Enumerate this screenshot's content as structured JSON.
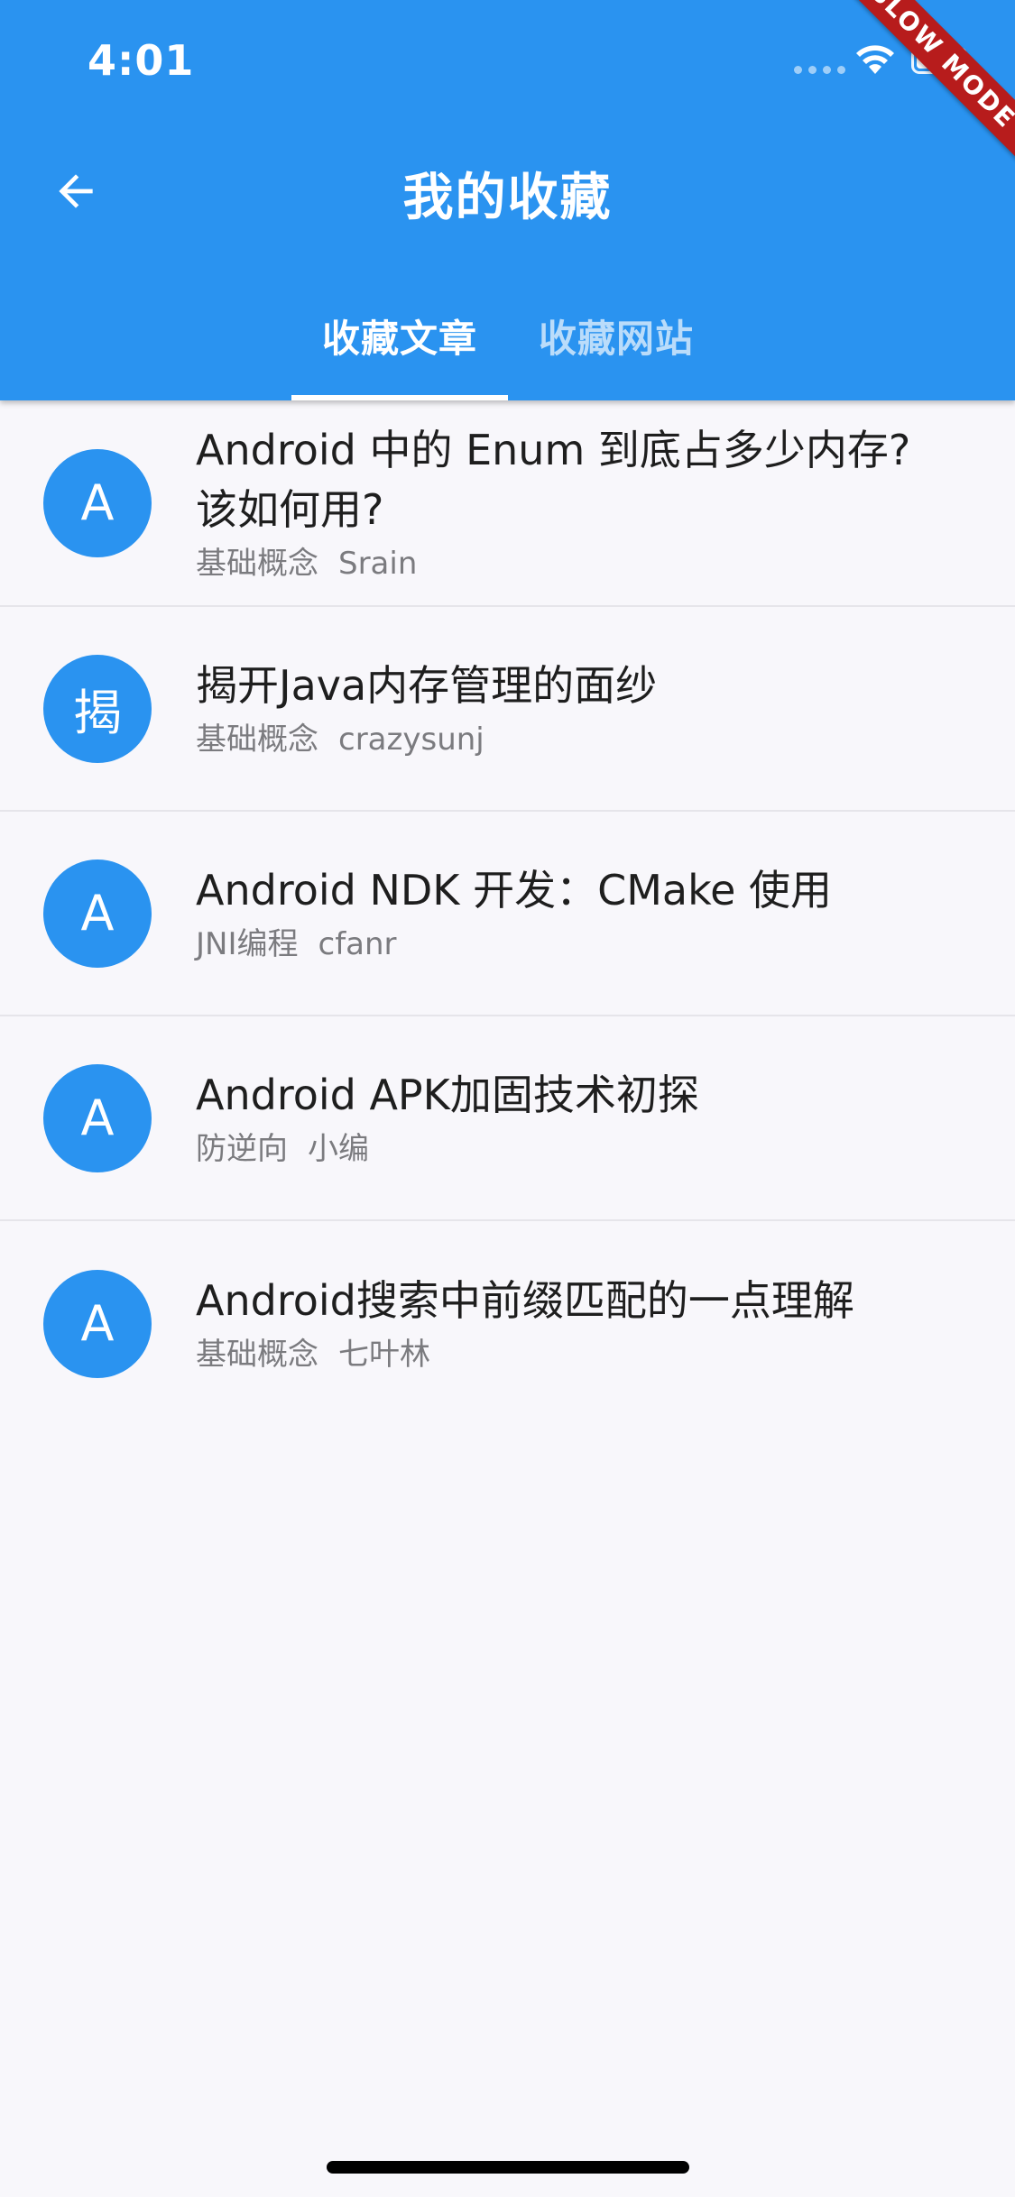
{
  "status_bar": {
    "time": "4:01"
  },
  "debug_banner": "SLOW MODE",
  "app_bar": {
    "title": "我的收藏",
    "background_color": "#2a93f0",
    "back_icon": "arrow-left-icon"
  },
  "tabs": [
    {
      "label": "收藏文章",
      "active": true
    },
    {
      "label": "收藏网站",
      "active": false
    }
  ],
  "articles": [
    {
      "avatar": "A",
      "title_line1": "Android 中的 Enum 到底占多少内存?",
      "title_line2": "该如何用?",
      "category": "基础概念",
      "author": "Srain"
    },
    {
      "avatar": "揭",
      "title_line1": "揭开Java内存管理的面纱",
      "title_line2": "",
      "category": "基础概念",
      "author": "crazysunj"
    },
    {
      "avatar": "A",
      "title_line1": "Android NDK 开发：CMake 使用",
      "title_line2": "",
      "category": "JNI编程",
      "author": "cfanr"
    },
    {
      "avatar": "A",
      "title_line1": "Android APK加固技术初探",
      "title_line2": "",
      "category": "防逆向",
      "author": "小编"
    },
    {
      "avatar": "A",
      "title_line1": "Android搜索中前缀匹配的一点理解",
      "title_line2": "",
      "category": "基础概念",
      "author": "七叶林"
    }
  ]
}
